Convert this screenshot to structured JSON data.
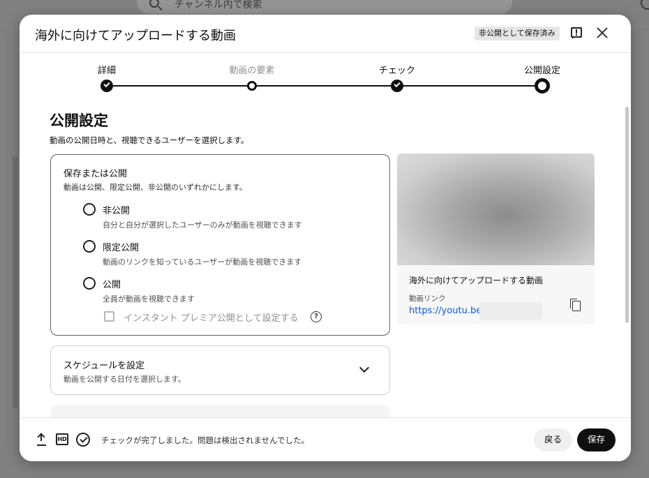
{
  "background": {
    "search_placeholder": "チャンネル内で検索"
  },
  "dialog": {
    "title": "海外に向けてアップロードする動画",
    "status_chip": "非公開として保存済み"
  },
  "stepper": {
    "steps": [
      {
        "label": "詳細",
        "state": "done"
      },
      {
        "label": "動画の要素",
        "state": "visited"
      },
      {
        "label": "チェック",
        "state": "done"
      },
      {
        "label": "公開設定",
        "state": "current"
      }
    ]
  },
  "visibility": {
    "title": "公開設定",
    "description": "動画の公開日時と、視聴できるユーザーを選択します。",
    "save_or_publish": {
      "title": "保存または公開",
      "description": "動画は公開、限定公開、非公開のいずれかにします。",
      "options": [
        {
          "label": "非公開",
          "sub": "自分と自分が選択したユーザーのみが動画を視聴できます",
          "selected": false
        },
        {
          "label": "限定公開",
          "sub": "動画のリンクを知っているユーザーが動画を視聴できます",
          "selected": false
        },
        {
          "label": "公開",
          "sub": "全員が動画を視聴できます",
          "selected": false
        }
      ],
      "premiere_checkbox": "インスタント プレミア公開として設定する",
      "help_glyph": "?"
    },
    "schedule": {
      "title": "スケジュールを設定",
      "description": "動画を公開する日付を選択します。"
    }
  },
  "preview": {
    "video_title": "海外に向けてアップロードする動画",
    "link_label": "動画リンク",
    "link_url": "https://youtu.be/"
  },
  "footer": {
    "hd_label": "HD",
    "status": "チェックが完了しました。問題は検出されませんでした。",
    "back_label": "戻る",
    "save_label": "保存"
  },
  "icons": [
    "search-icon",
    "help-icon",
    "feedback-icon",
    "close-icon",
    "check-icon",
    "chevron-down-icon",
    "copy-icon",
    "upload-icon",
    "hd-icon",
    "check-circle-icon"
  ],
  "colors": {
    "accent": "#0f0f0f",
    "link": "#065fd4",
    "chip_bg": "#e6e6e6",
    "backdrop": "#808080"
  }
}
